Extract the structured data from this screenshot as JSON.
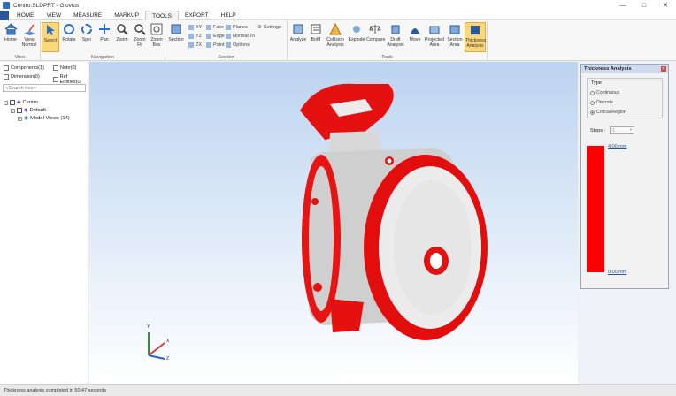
{
  "window": {
    "title": "Centro.SLDPRT - Glovius"
  },
  "menu": [
    "HOME",
    "VIEW",
    "MEASURE",
    "MARKUP",
    "TOOLS",
    "EXPORT",
    "HELP"
  ],
  "menu_active": "TOOLS",
  "ribbon": {
    "view_group": {
      "label": "View",
      "buttons": [
        "Home",
        "View Normal"
      ]
    },
    "navigation_group": {
      "label": "Navigation",
      "buttons": [
        "Select",
        "Rotate",
        "Spin",
        "Pan",
        "Zoom",
        "Zoom Fit",
        "Zoom Box"
      ]
    },
    "section_group": {
      "label": "Section",
      "section_label": "Section",
      "small": [
        "XY",
        "YZ",
        "ZX",
        "Face",
        "Edge",
        "Point",
        "Planes",
        "Normal To",
        "Options"
      ],
      "settings": "Settings"
    },
    "tools_group": {
      "label": "Tools",
      "buttons": [
        "Analyze",
        "BoM",
        "Collision Analysis",
        "Explode",
        "Compare",
        "Draft Analysis",
        "Move",
        "Projected Area",
        "Section Area",
        "Thickness Analysis"
      ]
    }
  },
  "left_panel": {
    "filters": [
      "Components(1)",
      "Note(0)",
      "Dimension(0)",
      "Ref Entities(0)"
    ],
    "search_placeholder": "<Search tree>",
    "tree": [
      "Centro",
      "Default",
      "Model Views (14)"
    ]
  },
  "thickness_panel": {
    "title": "Thickness Analysis",
    "type_label": "Type",
    "options": [
      "Continuous",
      "Discrete",
      "Critical Region"
    ],
    "selected_option": "Critical Region",
    "steps_label": "Steps :",
    "steps_value": "1",
    "max_label": "4.00 mm",
    "min_label": "0.00 mm",
    "bar_color": "#ff0000"
  },
  "axes": {
    "x": "X",
    "y": "Y",
    "z": "Z"
  },
  "status": "Thickness analysis completed in 50.47 seconds",
  "colors": {
    "accent": "#2b579a",
    "highlight": "#fbd77c",
    "model_red": "#e01010"
  }
}
